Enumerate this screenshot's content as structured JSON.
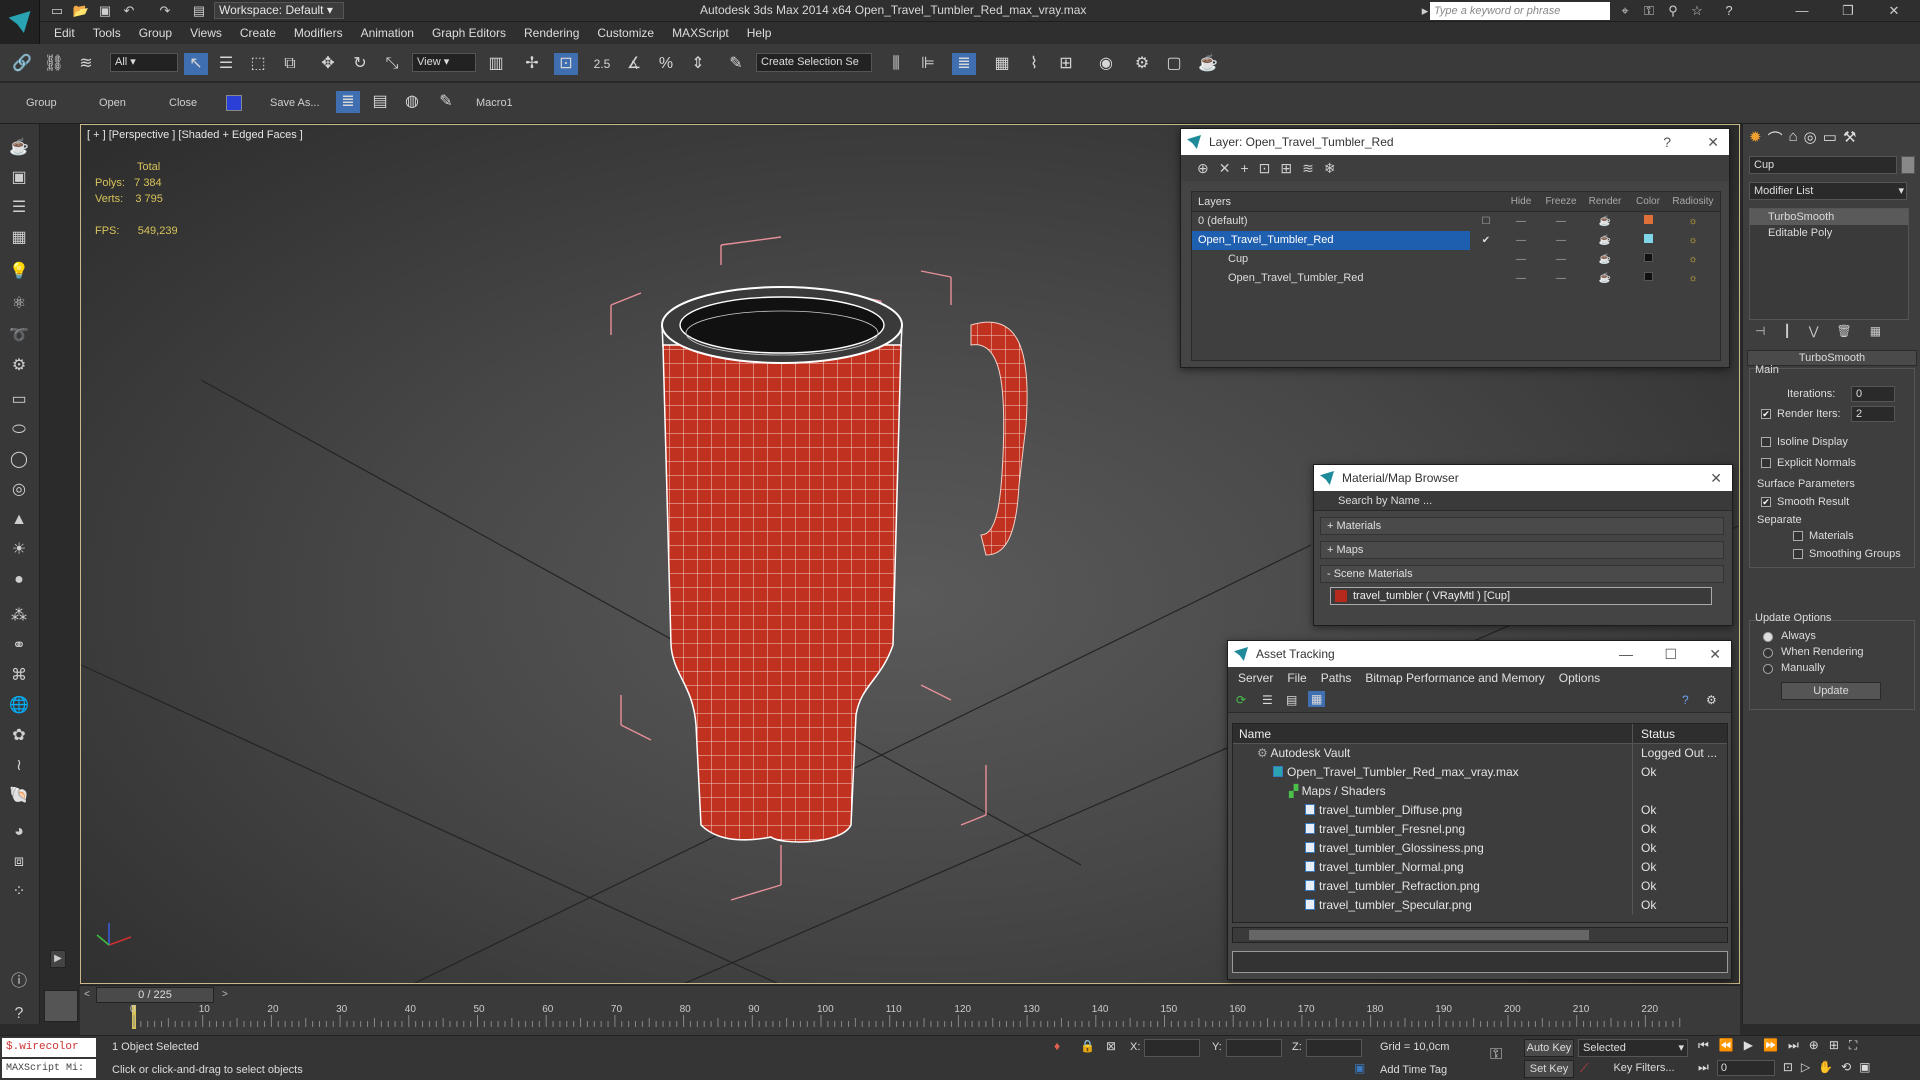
{
  "titlebar": {
    "workspace": "Workspace: Default",
    "title": "Autodesk 3ds Max  2014 x64     Open_Travel_Tumbler_Red_max_vray.max",
    "search_placeholder": "Type a keyword or phrase"
  },
  "menubar": [
    "Edit",
    "Tools",
    "Group",
    "Views",
    "Create",
    "Modifiers",
    "Animation",
    "Graph Editors",
    "Rendering",
    "Customize",
    "MAXScript",
    "Help"
  ],
  "toolbar": {
    "selection_filter": "All",
    "ref_coord": "View",
    "snap_value": "2.5",
    "selection_set": "Create Selection Se"
  },
  "ribbon": {
    "group": "Group",
    "open": "Open",
    "close": "Close",
    "save_as": "Save As...",
    "macro": "Macro1"
  },
  "viewport": {
    "label": "[ + ] [Perspective ] [Shaded + Edged Faces ]",
    "stats_header": "Total",
    "polys_label": "Polys:",
    "polys_value": "7 384",
    "verts_label": "Verts:",
    "verts_value": "3 795",
    "fps_label": "FPS:",
    "fps_value": "549,239",
    "object_color": "#c0321f"
  },
  "layer_dialog": {
    "title": "Layer: Open_Travel_Tumbler_Red",
    "columns": [
      "Layers",
      "Hide",
      "Freeze",
      "Render",
      "Color",
      "Radiosity"
    ],
    "rows": [
      {
        "name": "0 (default)",
        "color": "#e0703a",
        "selected": false
      },
      {
        "name": "Open_Travel_Tumbler_Red",
        "color": "#7fd6e8",
        "selected": true
      },
      {
        "name": "Cup",
        "color": "#111111",
        "selected": false
      },
      {
        "name": "Open_Travel_Tumbler_Red",
        "color": "#111111",
        "selected": false
      }
    ]
  },
  "material_browser": {
    "title": "Material/Map Browser",
    "search_placeholder": "Search by Name ...",
    "groups": [
      "+ Materials",
      "+ Maps",
      "- Scene Materials"
    ],
    "scene_item": "travel_tumbler  ( VRayMtl )  [Cup]"
  },
  "asset_tracking": {
    "title": "Asset Tracking",
    "menu": [
      "Server",
      "File",
      "Paths",
      "Bitmap Performance and Memory",
      "Options"
    ],
    "columns": [
      "Name",
      "Status"
    ],
    "rows": [
      {
        "name": "Autodesk Vault",
        "status": "Logged Out ...",
        "indent": 1,
        "icon": "vault-icon"
      },
      {
        "name": "Open_Travel_Tumbler_Red_max_vray.max",
        "status": "Ok",
        "indent": 2,
        "icon": "max-file-icon"
      },
      {
        "name": "Maps / Shaders",
        "status": "",
        "indent": 3,
        "icon": "maps-icon"
      },
      {
        "name": "travel_tumbler_Diffuse.png",
        "status": "Ok",
        "indent": 4,
        "icon": "image-file-icon"
      },
      {
        "name": "travel_tumbler_Fresnel.png",
        "status": "Ok",
        "indent": 4,
        "icon": "image-file-icon"
      },
      {
        "name": "travel_tumbler_Glossiness.png",
        "status": "Ok",
        "indent": 4,
        "icon": "image-file-icon"
      },
      {
        "name": "travel_tumbler_Normal.png",
        "status": "Ok",
        "indent": 4,
        "icon": "image-file-icon"
      },
      {
        "name": "travel_tumbler_Refraction.png",
        "status": "Ok",
        "indent": 4,
        "icon": "image-file-icon"
      },
      {
        "name": "travel_tumbler_Specular.png",
        "status": "Ok",
        "indent": 4,
        "icon": "image-file-icon"
      }
    ]
  },
  "command_panel": {
    "object_name": "Cup",
    "modifier_list": "Modifier List",
    "stack": [
      "TurboSmooth",
      "Editable Poly"
    ],
    "rollout_title": "TurboSmooth",
    "main_label": "Main",
    "iterations_label": "Iterations:",
    "iterations_value": "0",
    "render_iters_label": "Render Iters:",
    "render_iters_value": "2",
    "isoline": "Isoline Display",
    "explicit_normals": "Explicit Normals",
    "surface_params": "Surface Parameters",
    "smooth_result": "Smooth Result",
    "separate": "Separate",
    "materials": "Materials",
    "smoothing_groups": "Smoothing Groups",
    "update_options": "Update Options",
    "always": "Always",
    "when_rendering": "When Rendering",
    "manually": "Manually",
    "update_button": "Update"
  },
  "timeline": {
    "frame_counter": "0 / 225",
    "ticks": [
      "0",
      "10",
      "20",
      "30",
      "40",
      "50",
      "60",
      "70",
      "80",
      "90",
      "100",
      "110",
      "120",
      "130",
      "140",
      "150",
      "160",
      "170",
      "180",
      "190",
      "200",
      "210",
      "220"
    ]
  },
  "statusbar": {
    "script_label": "$.wirecolor",
    "maxscript_label": "MAXScript Mi:",
    "selected_text": "1 Object Selected",
    "prompt_text": "Click or click-and-drag to select objects",
    "x_label": "X:",
    "y_label": "Y:",
    "z_label": "Z:",
    "grid": "Grid = 10,0cm",
    "auto_key": "Auto Key",
    "selected_dropdown": "Selected",
    "set_key": "Set Key",
    "key_filters": "Key Filters...",
    "add_time_tag": "Add Time Tag",
    "frame_value": "0"
  }
}
